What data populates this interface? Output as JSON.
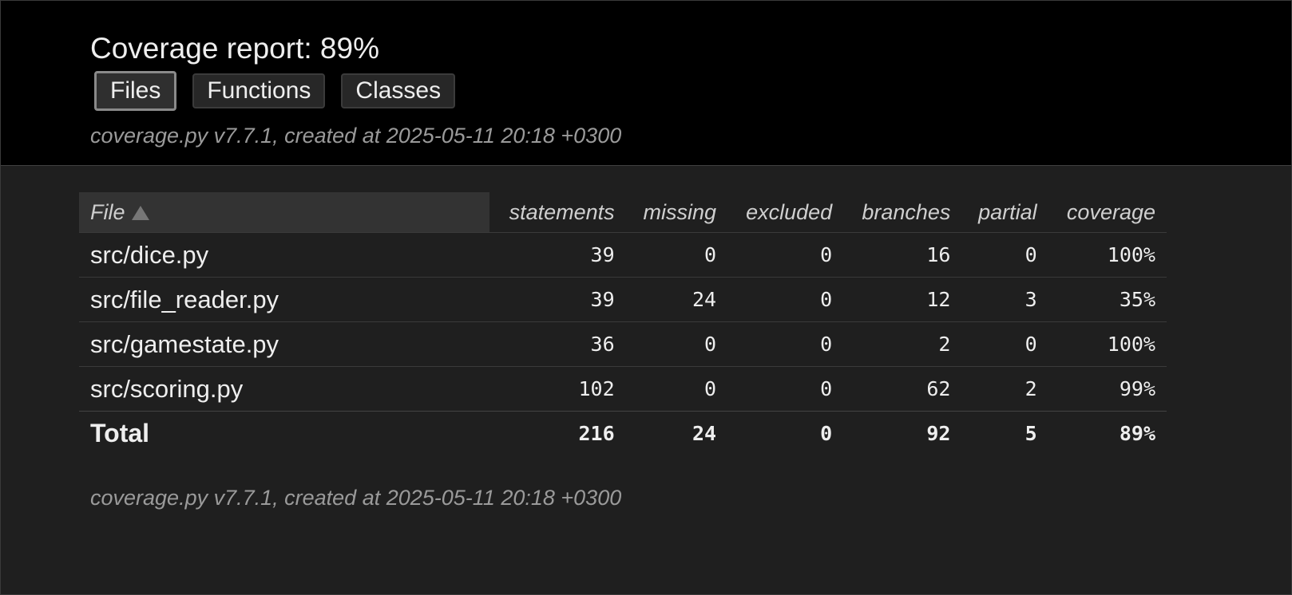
{
  "header": {
    "title": "Coverage report: 89%",
    "tabs": [
      {
        "label": "Files",
        "active": true
      },
      {
        "label": "Functions",
        "active": false
      },
      {
        "label": "Classes",
        "active": false
      }
    ],
    "created": "coverage.py v7.7.1, created at 2025-05-11 20:18 +0300"
  },
  "table": {
    "columns": [
      "File",
      "statements",
      "missing",
      "excluded",
      "branches",
      "partial",
      "coverage"
    ],
    "sort": {
      "column": "File",
      "direction": "ascending",
      "icon": "sort-ascending-icon"
    },
    "rows": [
      {
        "file": "src/dice.py",
        "statements": "39",
        "missing": "0",
        "excluded": "0",
        "branches": "16",
        "partial": "0",
        "coverage": "100%"
      },
      {
        "file": "src/file_reader.py",
        "statements": "39",
        "missing": "24",
        "excluded": "0",
        "branches": "12",
        "partial": "3",
        "coverage": "35%"
      },
      {
        "file": "src/gamestate.py",
        "statements": "36",
        "missing": "0",
        "excluded": "0",
        "branches": "2",
        "partial": "0",
        "coverage": "100%"
      },
      {
        "file": "src/scoring.py",
        "statements": "102",
        "missing": "0",
        "excluded": "0",
        "branches": "62",
        "partial": "2",
        "coverage": "99%"
      }
    ],
    "total": {
      "file": "Total",
      "statements": "216",
      "missing": "24",
      "excluded": "0",
      "branches": "92",
      "partial": "5",
      "coverage": "89%"
    }
  },
  "footer": {
    "created": "coverage.py v7.7.1, created at 2025-05-11 20:18 +0300"
  },
  "colors": {
    "header_bg": "#000000",
    "page_bg": "#1f1f1f",
    "text": "#eeeeee",
    "muted": "#9a9a9a"
  }
}
